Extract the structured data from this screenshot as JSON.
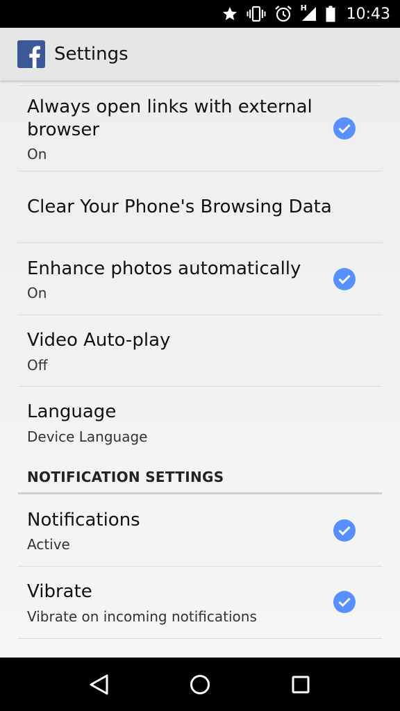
{
  "status_bar": {
    "time": "10:43",
    "network_label": "H",
    "icons": [
      "star-icon",
      "vibrate-icon",
      "alarm-icon",
      "signal-icon",
      "battery-icon"
    ]
  },
  "app_bar": {
    "title": "Settings",
    "logo": "facebook-logo"
  },
  "settings": [
    {
      "title": "Always open links with external browser",
      "subtitle": "On",
      "checked": true
    },
    {
      "title": "Clear Your Phone's Browsing Data",
      "subtitle": "",
      "checked": false
    },
    {
      "title": "Enhance photos automatically",
      "subtitle": "On",
      "checked": true
    },
    {
      "title": "Video Auto-play",
      "subtitle": "Off",
      "checked": false
    },
    {
      "title": "Language",
      "subtitle": "Device Language",
      "checked": false
    }
  ],
  "notification_section": {
    "header": "NOTIFICATION SETTINGS",
    "items": [
      {
        "title": "Notifications",
        "subtitle": "Active",
        "checked": true
      },
      {
        "title": "Vibrate",
        "subtitle": "Vibrate on incoming notifications",
        "checked": true
      }
    ]
  },
  "colors": {
    "check_blue": "#5890ff",
    "facebook_blue": "#3b5998",
    "app_bar": "#e6e6e6"
  },
  "nav_bar": {
    "buttons": [
      "back-icon",
      "home-icon",
      "recents-icon"
    ]
  }
}
